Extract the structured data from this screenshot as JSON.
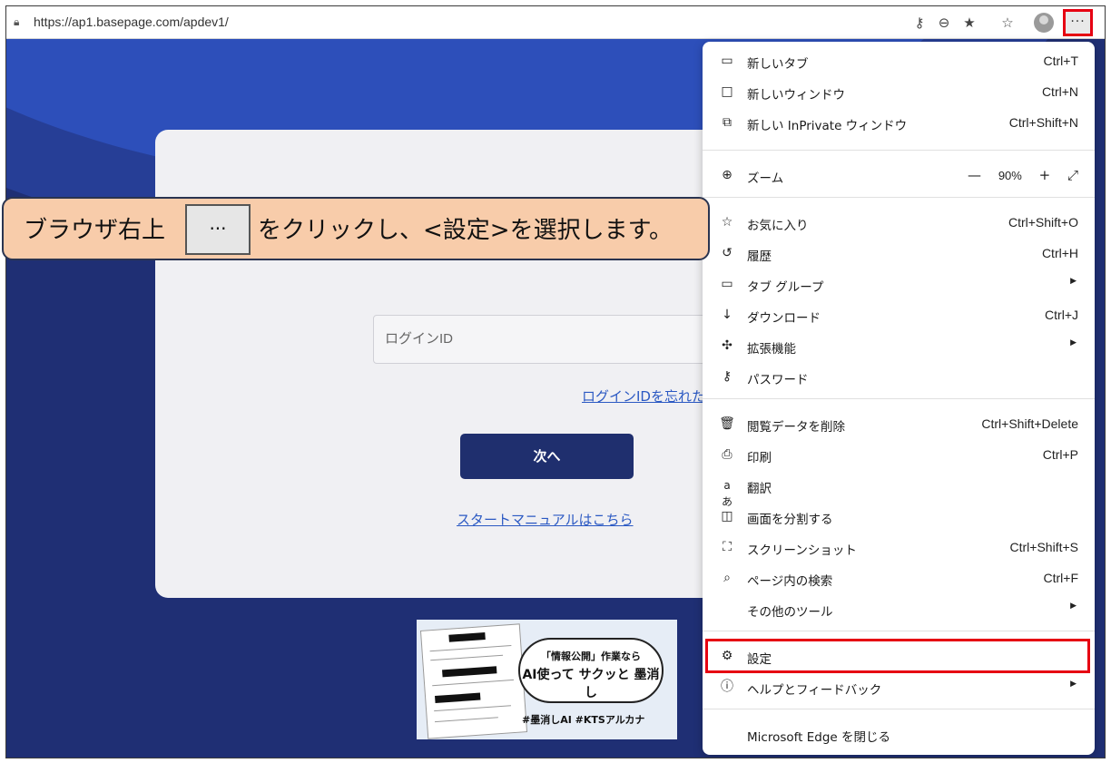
{
  "browser": {
    "url": "https://ap1.basepage.com/apdev1/",
    "more_button": "···"
  },
  "page": {
    "login_placeholder": "ログインID",
    "forgot_link": "ログインIDを忘れた",
    "next_button": "次へ",
    "manual_link": "スタートマニュアルはこちら",
    "ad": {
      "line1": "「情報公開」作業なら",
      "line2": "AI使って サクッと 墨消し",
      "tags": "#墨消しAI  #KTSアルカナ"
    }
  },
  "callout": {
    "before": "ブラウザ右上",
    "key": "···",
    "after": "をクリックし、<設定>を選択します。"
  },
  "menu": {
    "new_tab": {
      "label": "新しいタブ",
      "shortcut": "Ctrl+T"
    },
    "new_window": {
      "label": "新しいウィンドウ",
      "shortcut": "Ctrl+N"
    },
    "new_inprivate": {
      "label": "新しい InPrivate ウィンドウ",
      "shortcut": "Ctrl+Shift+N"
    },
    "zoom": {
      "label": "ズーム",
      "minus": "—",
      "value": "90%",
      "plus": "+",
      "fullscreen": "⤢"
    },
    "favorites": {
      "label": "お気に入り",
      "shortcut": "Ctrl+Shift+O"
    },
    "history": {
      "label": "履歴",
      "shortcut": "Ctrl+H"
    },
    "tab_groups": {
      "label": "タブ グループ"
    },
    "downloads": {
      "label": "ダウンロード",
      "shortcut": "Ctrl+J"
    },
    "extensions": {
      "label": "拡張機能"
    },
    "passwords": {
      "label": "パスワード"
    },
    "clear_data": {
      "label": "閲覧データを削除",
      "shortcut": "Ctrl+Shift+Delete"
    },
    "print": {
      "label": "印刷",
      "shortcut": "Ctrl+P"
    },
    "translate": {
      "label": "翻訳"
    },
    "split_screen": {
      "label": "画面を分割する"
    },
    "screenshot": {
      "label": "スクリーンショット",
      "shortcut": "Ctrl+Shift+S"
    },
    "find": {
      "label": "ページ内の検索",
      "shortcut": "Ctrl+F"
    },
    "more_tools": {
      "label": "その他のツール"
    },
    "settings": {
      "label": "設定"
    },
    "help": {
      "label": "ヘルプとフィードバック"
    },
    "close_edge": {
      "label": "Microsoft Edge を閉じる"
    }
  },
  "accent_colors": {
    "highlight": "#e60012",
    "callout_bg": "#f8ccaa",
    "page_bg": "#1f2f74"
  }
}
